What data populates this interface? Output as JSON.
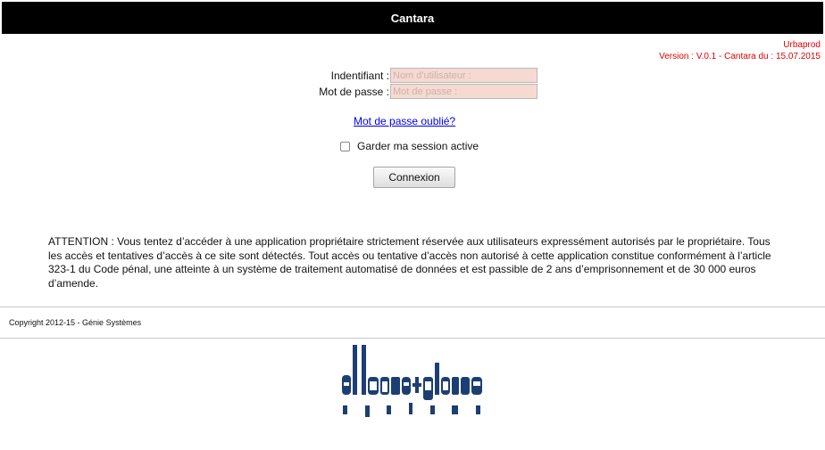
{
  "header": {
    "title": "Cantara"
  },
  "version_info": {
    "line1": "Urbaprod",
    "line2": "Version : V.0.1 - Cantara du : 15.07.2015"
  },
  "login": {
    "username_label": "Indentifiant :",
    "username_placeholder": "Nom d'utilisateur :",
    "password_label": "Mot de passe :",
    "password_placeholder": "Mot de passe :",
    "forgot_link": "Mot de passe oublié?",
    "remember_label": "Garder ma session active",
    "submit_label": "Connexion"
  },
  "warning": "ATTENTION : Vous tentez d’accéder à une application propriétaire strictement réservée aux utilisateurs expressément autorisés par le propriétaire. Tous les accès et tentatives d’accès à ce site sont détectés. Tout accès ou tentative d’accès non autorisé à cette application constitue conformément à l’article 323-1 du Code pénal, une atteinte à un système de traitement automatisé de données et est passible de 2 ans d’emprisonnement et de 30 000 euros d’amende.",
  "footer": {
    "copyright": "Copyright 2012-15 - Génie Systèmes"
  },
  "logo": {
    "brand": "ellouze+partners",
    "tagline": "systems"
  },
  "colors": {
    "header_bg": "#000000",
    "version_text": "#e00000",
    "field_bg": "#f6d9d1",
    "link": "#0000ee",
    "logo": "#1c3f73"
  }
}
